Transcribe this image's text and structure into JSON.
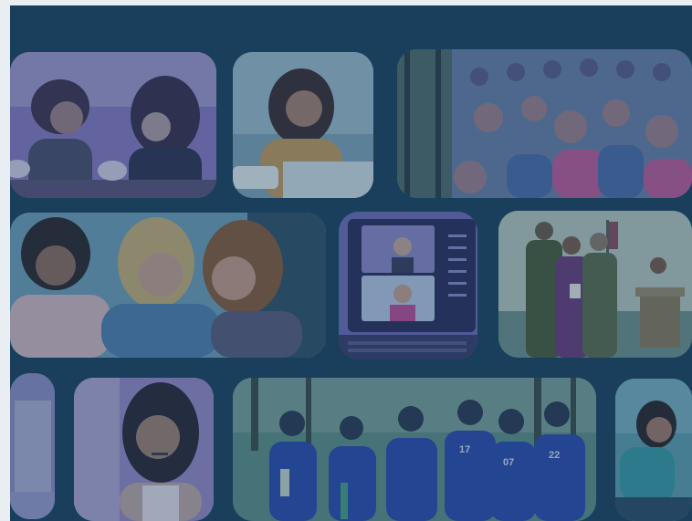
{
  "collage": {
    "background": "#1a3f5c",
    "overlay": "#1a3f5c",
    "tiles": [
      {
        "name": "photo-two-women-coffee",
        "tint": "#8a78c4"
      },
      {
        "name": "photo-woman-laptop",
        "tint": "#7fa3b8"
      },
      {
        "name": "photo-group-women-selfie",
        "tint": "#6a7ea8"
      },
      {
        "name": "photo-three-women-laughing",
        "tint": "#6f9fb8"
      },
      {
        "name": "photo-video-call-laptop",
        "tint": "#6e6ab8"
      },
      {
        "name": "photo-military-ceremony",
        "tint": "#6f8f8a"
      },
      {
        "name": "photo-partial-left",
        "tint": "#8e8ec8"
      },
      {
        "name": "photo-woman-headset",
        "tint": "#9a88c8"
      },
      {
        "name": "photo-team-uniforms",
        "tint": "#5f8f86"
      },
      {
        "name": "photo-woman-sitting",
        "tint": "#5f9fb0"
      }
    ]
  }
}
